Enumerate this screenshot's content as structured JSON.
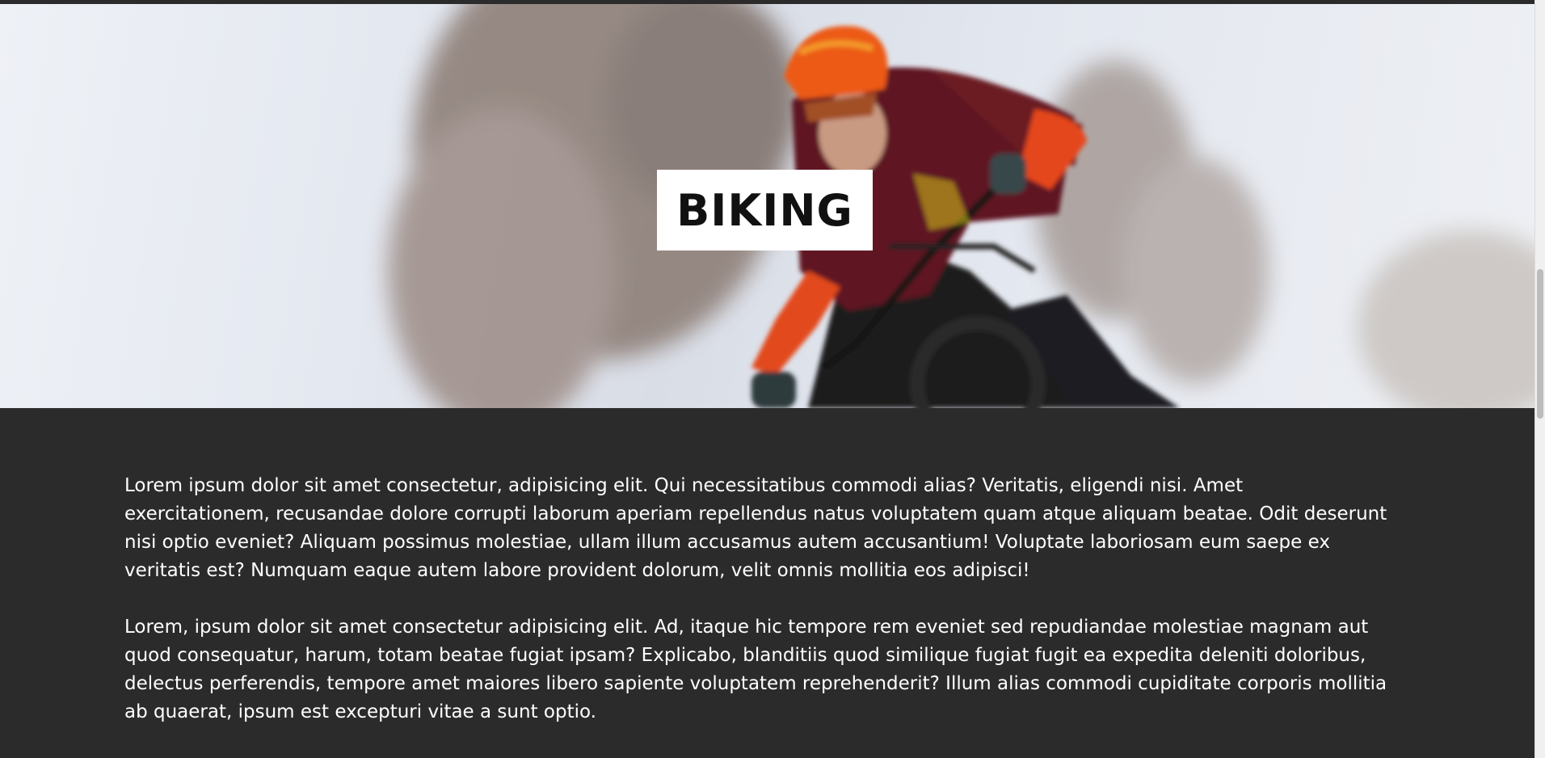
{
  "hero": {
    "title": "BIKING",
    "image": "mountain-biker-photo"
  },
  "content": {
    "paragraphs": [
      "Lorem ipsum dolor sit amet consectetur, adipisicing elit. Qui necessitatibus commodi alias? Veritatis, eligendi nisi. Amet exercitationem, recusandae dolore corrupti laborum aperiam repellendus natus voluptatem quam atque aliquam beatae. Odit deserunt nisi optio eveniet? Aliquam possimus molestiae, ullam illum accusamus autem accusantium! Voluptate laboriosam eum saepe ex veritatis est? Numquam eaque autem labore provident dolorum, velit omnis mollitia eos adipisci!",
      "Lorem, ipsum dolor sit amet consectetur adipisicing elit. Ad, itaque hic tempore rem eveniet sed repudiandae molestiae magnam aut quod consequatur, harum, totam beatae fugiat ipsam? Explicabo, blanditiis quod similique fugiat fugit ea expedita deleniti doloribus, delectus perferendis, tempore amet maiores libero sapiente voluptatem reprehenderit? Illum alias commodi cupiditate corporis mollitia ab quaerat, ipsum est excepturi vitae a sunt optio."
    ]
  },
  "colors": {
    "background": "#2b2b2b",
    "text": "#ffffff",
    "title_box": "#ffffff",
    "title_text": "#111111"
  },
  "scrollbar": {
    "position_fraction": 0.35
  }
}
